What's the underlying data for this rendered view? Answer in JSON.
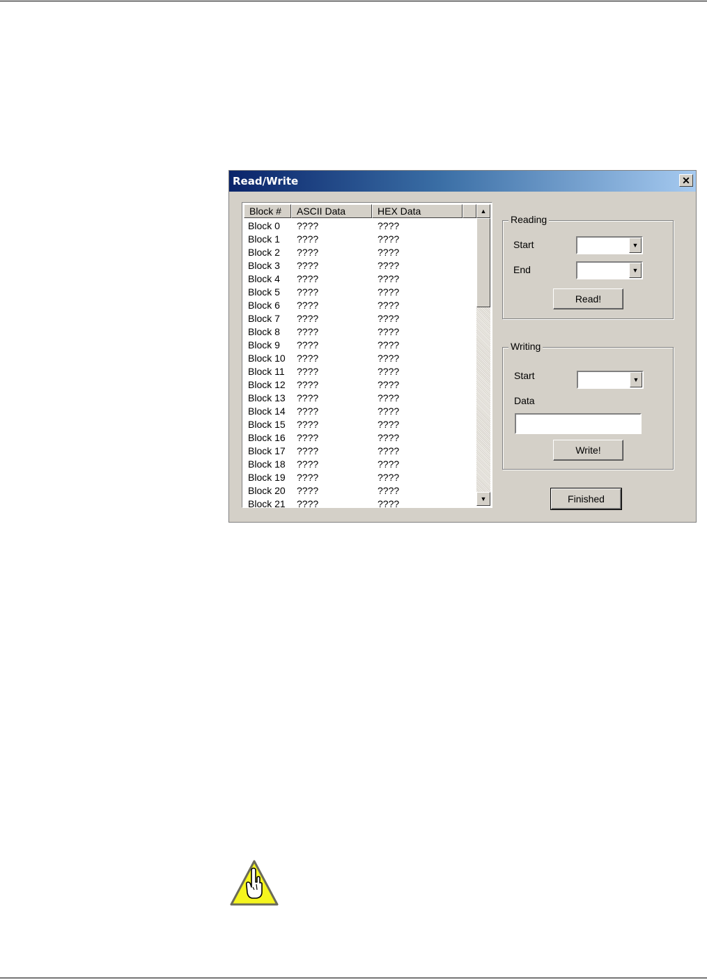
{
  "window": {
    "title": "Read/Write",
    "close_glyph": "✕"
  },
  "list": {
    "columns": [
      "Block #",
      "ASCII Data",
      "HEX Data"
    ],
    "rows": [
      {
        "block": "Block  0",
        "ascii": "????",
        "hex": "????"
      },
      {
        "block": "Block  1",
        "ascii": "????",
        "hex": "????"
      },
      {
        "block": "Block  2",
        "ascii": "????",
        "hex": "????"
      },
      {
        "block": "Block  3",
        "ascii": "????",
        "hex": "????"
      },
      {
        "block": "Block  4",
        "ascii": "????",
        "hex": "????"
      },
      {
        "block": "Block  5",
        "ascii": "????",
        "hex": "????"
      },
      {
        "block": "Block  6",
        "ascii": "????",
        "hex": "????"
      },
      {
        "block": "Block  7",
        "ascii": "????",
        "hex": "????"
      },
      {
        "block": "Block  8",
        "ascii": "????",
        "hex": "????"
      },
      {
        "block": "Block  9",
        "ascii": "????",
        "hex": "????"
      },
      {
        "block": "Block 10",
        "ascii": "????",
        "hex": "????"
      },
      {
        "block": "Block 11",
        "ascii": "????",
        "hex": "????"
      },
      {
        "block": "Block 12",
        "ascii": "????",
        "hex": "????"
      },
      {
        "block": "Block 13",
        "ascii": "????",
        "hex": "????"
      },
      {
        "block": "Block 14",
        "ascii": "????",
        "hex": "????"
      },
      {
        "block": "Block 15",
        "ascii": "????",
        "hex": "????"
      },
      {
        "block": "Block 16",
        "ascii": "????",
        "hex": "????"
      },
      {
        "block": "Block 17",
        "ascii": "????",
        "hex": "????"
      },
      {
        "block": "Block 18",
        "ascii": "????",
        "hex": "????"
      },
      {
        "block": "Block 19",
        "ascii": "????",
        "hex": "????"
      },
      {
        "block": "Block 20",
        "ascii": "????",
        "hex": "????"
      },
      {
        "block": "Block 21",
        "ascii": "????",
        "hex": "????"
      }
    ]
  },
  "reading": {
    "title": "Reading",
    "start_label": "Start",
    "start_value": "",
    "end_label": "End",
    "end_value": "",
    "button": "Read!"
  },
  "writing": {
    "title": "Writing",
    "start_label": "Start",
    "start_value": "",
    "data_label": "Data",
    "data_value": "",
    "button": "Write!"
  },
  "finished_button": "Finished",
  "icons": {
    "scroll_up": "▲",
    "scroll_down": "▼",
    "dropdown": "▼",
    "warning": "caution-hand-icon"
  },
  "colors": {
    "dialog_bg": "#d4d0c8",
    "title_start": "#0a246a",
    "title_end": "#a6caf0",
    "warning_yellow": "#f5f51e"
  }
}
